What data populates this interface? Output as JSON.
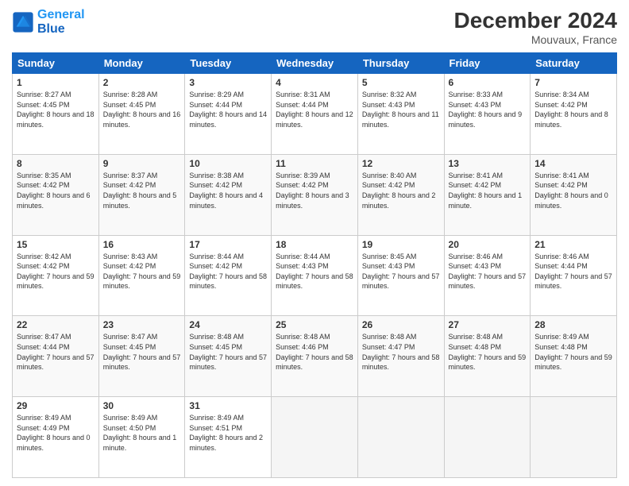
{
  "logo": {
    "line1": "General",
    "line2": "Blue"
  },
  "header": {
    "title": "December 2024",
    "subtitle": "Mouvaux, France"
  },
  "weekdays": [
    "Sunday",
    "Monday",
    "Tuesday",
    "Wednesday",
    "Thursday",
    "Friday",
    "Saturday"
  ],
  "weeks": [
    [
      {
        "day": "1",
        "sunrise": "8:27 AM",
        "sunset": "4:45 PM",
        "daylight": "8 hours and 18 minutes."
      },
      {
        "day": "2",
        "sunrise": "8:28 AM",
        "sunset": "4:45 PM",
        "daylight": "8 hours and 16 minutes."
      },
      {
        "day": "3",
        "sunrise": "8:29 AM",
        "sunset": "4:44 PM",
        "daylight": "8 hours and 14 minutes."
      },
      {
        "day": "4",
        "sunrise": "8:31 AM",
        "sunset": "4:44 PM",
        "daylight": "8 hours and 12 minutes."
      },
      {
        "day": "5",
        "sunrise": "8:32 AM",
        "sunset": "4:43 PM",
        "daylight": "8 hours and 11 minutes."
      },
      {
        "day": "6",
        "sunrise": "8:33 AM",
        "sunset": "4:43 PM",
        "daylight": "8 hours and 9 minutes."
      },
      {
        "day": "7",
        "sunrise": "8:34 AM",
        "sunset": "4:42 PM",
        "daylight": "8 hours and 8 minutes."
      }
    ],
    [
      {
        "day": "8",
        "sunrise": "8:35 AM",
        "sunset": "4:42 PM",
        "daylight": "8 hours and 6 minutes."
      },
      {
        "day": "9",
        "sunrise": "8:37 AM",
        "sunset": "4:42 PM",
        "daylight": "8 hours and 5 minutes."
      },
      {
        "day": "10",
        "sunrise": "8:38 AM",
        "sunset": "4:42 PM",
        "daylight": "8 hours and 4 minutes."
      },
      {
        "day": "11",
        "sunrise": "8:39 AM",
        "sunset": "4:42 PM",
        "daylight": "8 hours and 3 minutes."
      },
      {
        "day": "12",
        "sunrise": "8:40 AM",
        "sunset": "4:42 PM",
        "daylight": "8 hours and 2 minutes."
      },
      {
        "day": "13",
        "sunrise": "8:41 AM",
        "sunset": "4:42 PM",
        "daylight": "8 hours and 1 minute."
      },
      {
        "day": "14",
        "sunrise": "8:41 AM",
        "sunset": "4:42 PM",
        "daylight": "8 hours and 0 minutes."
      }
    ],
    [
      {
        "day": "15",
        "sunrise": "8:42 AM",
        "sunset": "4:42 PM",
        "daylight": "7 hours and 59 minutes."
      },
      {
        "day": "16",
        "sunrise": "8:43 AM",
        "sunset": "4:42 PM",
        "daylight": "7 hours and 59 minutes."
      },
      {
        "day": "17",
        "sunrise": "8:44 AM",
        "sunset": "4:42 PM",
        "daylight": "7 hours and 58 minutes."
      },
      {
        "day": "18",
        "sunrise": "8:44 AM",
        "sunset": "4:43 PM",
        "daylight": "7 hours and 58 minutes."
      },
      {
        "day": "19",
        "sunrise": "8:45 AM",
        "sunset": "4:43 PM",
        "daylight": "7 hours and 57 minutes."
      },
      {
        "day": "20",
        "sunrise": "8:46 AM",
        "sunset": "4:43 PM",
        "daylight": "7 hours and 57 minutes."
      },
      {
        "day": "21",
        "sunrise": "8:46 AM",
        "sunset": "4:44 PM",
        "daylight": "7 hours and 57 minutes."
      }
    ],
    [
      {
        "day": "22",
        "sunrise": "8:47 AM",
        "sunset": "4:44 PM",
        "daylight": "7 hours and 57 minutes."
      },
      {
        "day": "23",
        "sunrise": "8:47 AM",
        "sunset": "4:45 PM",
        "daylight": "7 hours and 57 minutes."
      },
      {
        "day": "24",
        "sunrise": "8:48 AM",
        "sunset": "4:45 PM",
        "daylight": "7 hours and 57 minutes."
      },
      {
        "day": "25",
        "sunrise": "8:48 AM",
        "sunset": "4:46 PM",
        "daylight": "7 hours and 58 minutes."
      },
      {
        "day": "26",
        "sunrise": "8:48 AM",
        "sunset": "4:47 PM",
        "daylight": "7 hours and 58 minutes."
      },
      {
        "day": "27",
        "sunrise": "8:48 AM",
        "sunset": "4:48 PM",
        "daylight": "7 hours and 59 minutes."
      },
      {
        "day": "28",
        "sunrise": "8:49 AM",
        "sunset": "4:48 PM",
        "daylight": "7 hours and 59 minutes."
      }
    ],
    [
      {
        "day": "29",
        "sunrise": "8:49 AM",
        "sunset": "4:49 PM",
        "daylight": "8 hours and 0 minutes."
      },
      {
        "day": "30",
        "sunrise": "8:49 AM",
        "sunset": "4:50 PM",
        "daylight": "8 hours and 1 minute."
      },
      {
        "day": "31",
        "sunrise": "8:49 AM",
        "sunset": "4:51 PM",
        "daylight": "8 hours and 2 minutes."
      },
      null,
      null,
      null,
      null
    ]
  ],
  "labels": {
    "sunrise": "Sunrise:",
    "sunset": "Sunset:",
    "daylight": "Daylight:"
  }
}
